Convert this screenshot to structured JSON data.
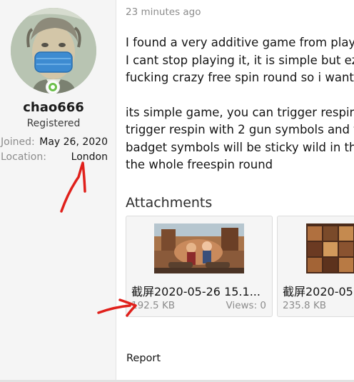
{
  "author": {
    "username": "chao666",
    "user_title": "Registered",
    "joined_label": "Joined:",
    "joined_value": "May 26, 2020",
    "location_label": "Location:",
    "location_value": "London",
    "avatar_icon": "avatar-image",
    "status_icon": "online-status-icon"
  },
  "post": {
    "time": "23 minutes ago",
    "lines_p1": [
      "I found a very additive game from play",
      "I cant stop playing it, it is simple but ez",
      "fucking crazy free spin round so i want"
    ],
    "lines_p2": [
      "its simple game, you can trigger respin",
      "trigger respin with 2 gun symbols and f",
      "badget symbols will be sticky wild in th",
      "the whole freespin round"
    ]
  },
  "attachments": {
    "title": "Attachments",
    "items": [
      {
        "name": "截屏2020-05-26 15.1...",
        "size": "192.5 KB",
        "views": "Views: 0"
      },
      {
        "name": "截屏2020-05",
        "size": "235.8 KB",
        "views": ""
      }
    ]
  },
  "actions": {
    "report": "Report"
  },
  "colors": {
    "annotation": "#e0201b",
    "online": "#6cbf4b",
    "sidebar_bg": "#f5f5f5"
  }
}
